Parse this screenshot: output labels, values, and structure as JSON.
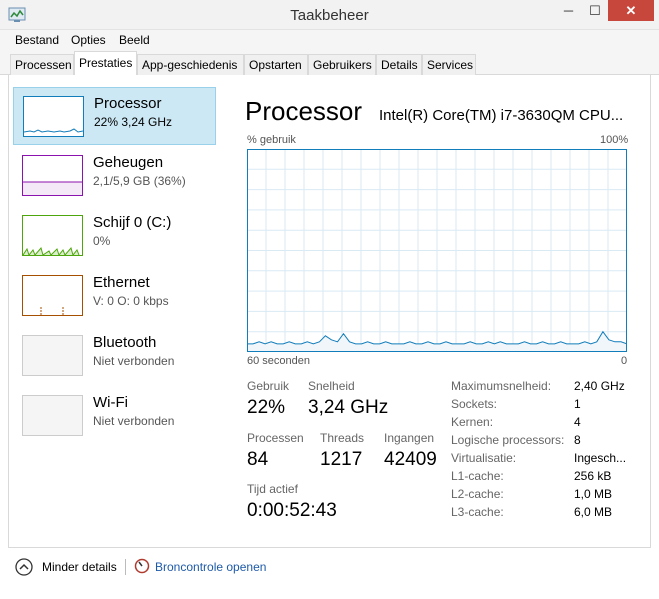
{
  "window": {
    "title": "Taakbeheer",
    "minimize_glyph": "─",
    "maximize_glyph": "☐",
    "close_glyph": "✕",
    "accent": "#c7473d"
  },
  "menu": [
    "Bestand",
    "Opties",
    "Beeld"
  ],
  "tabs": [
    "Processen",
    "Prestaties",
    "App-geschiedenis",
    "Opstarten",
    "Gebruikers",
    "Details",
    "Services"
  ],
  "active_tab": "Prestaties",
  "resources": [
    {
      "name": "Processor",
      "detail": "22% 3,24 GHz",
      "selected": true,
      "color": "#117dbb"
    },
    {
      "name": "Geheugen",
      "detail": "2,1/5,9 GB (36%)",
      "selected": false,
      "color": "#8b12ae"
    },
    {
      "name": "Schijf 0 (C:)",
      "detail": "0%",
      "selected": false,
      "color": "#4da60c"
    },
    {
      "name": "Ethernet",
      "detail": "V: 0 O: 0 kbps",
      "selected": false,
      "color": "#a74f01"
    },
    {
      "name": "Bluetooth",
      "detail": "Niet verbonden",
      "selected": false,
      "color": "#cccccc"
    },
    {
      "name": "Wi-Fi",
      "detail": "Niet verbonden",
      "selected": false,
      "color": "#cccccc"
    }
  ],
  "panel": {
    "title": "Processor",
    "cpu_model": "Intel(R) Core(TM) i7-3630QM CPU...",
    "axis_label": "% gebruik",
    "axis_max": "100%",
    "time_span": "60 seconden",
    "time_end": "0",
    "graph_color": "#117dbb",
    "usage_history": [
      4,
      4,
      5,
      4,
      5,
      4,
      4,
      5,
      4,
      4,
      5,
      4,
      5,
      8,
      6,
      5,
      9,
      5,
      4,
      4,
      5,
      4,
      4,
      5,
      4,
      4,
      4,
      5,
      4,
      4,
      5,
      4,
      4,
      5,
      4,
      4,
      4,
      5,
      4,
      4,
      5,
      4,
      5,
      4,
      4,
      4,
      5,
      4,
      4,
      5,
      4,
      4,
      5,
      4,
      4,
      4,
      5,
      4,
      5,
      10,
      6,
      5,
      5,
      4
    ]
  },
  "stats": {
    "usage_label": "Gebruik",
    "usage_value": "22%",
    "speed_label": "Snelheid",
    "speed_value": "3,24 GHz",
    "processes_label": "Processen",
    "processes_value": "84",
    "threads_label": "Threads",
    "threads_value": "1217",
    "handles_label": "Ingangen",
    "handles_value": "42409",
    "uptime_label": "Tijd actief",
    "uptime_value": "0:00:52:43"
  },
  "specs": [
    {
      "label": "Maximumsnelheid:",
      "value": "2,40 GHz"
    },
    {
      "label": "Sockets:",
      "value": "1"
    },
    {
      "label": "Kernen:",
      "value": "4"
    },
    {
      "label": "Logische processors:",
      "value": "8"
    },
    {
      "label": "Virtualisatie:",
      "value": "Ingesch..."
    },
    {
      "label": "L1-cache:",
      "value": "256 kB"
    },
    {
      "label": "L2-cache:",
      "value": "1,0 MB"
    },
    {
      "label": "L3-cache:",
      "value": "6,0 MB"
    }
  ],
  "footer": {
    "fewer_details": "Minder details",
    "open_monitor": "Broncontrole openen",
    "link_color": "#1e5aa8"
  }
}
